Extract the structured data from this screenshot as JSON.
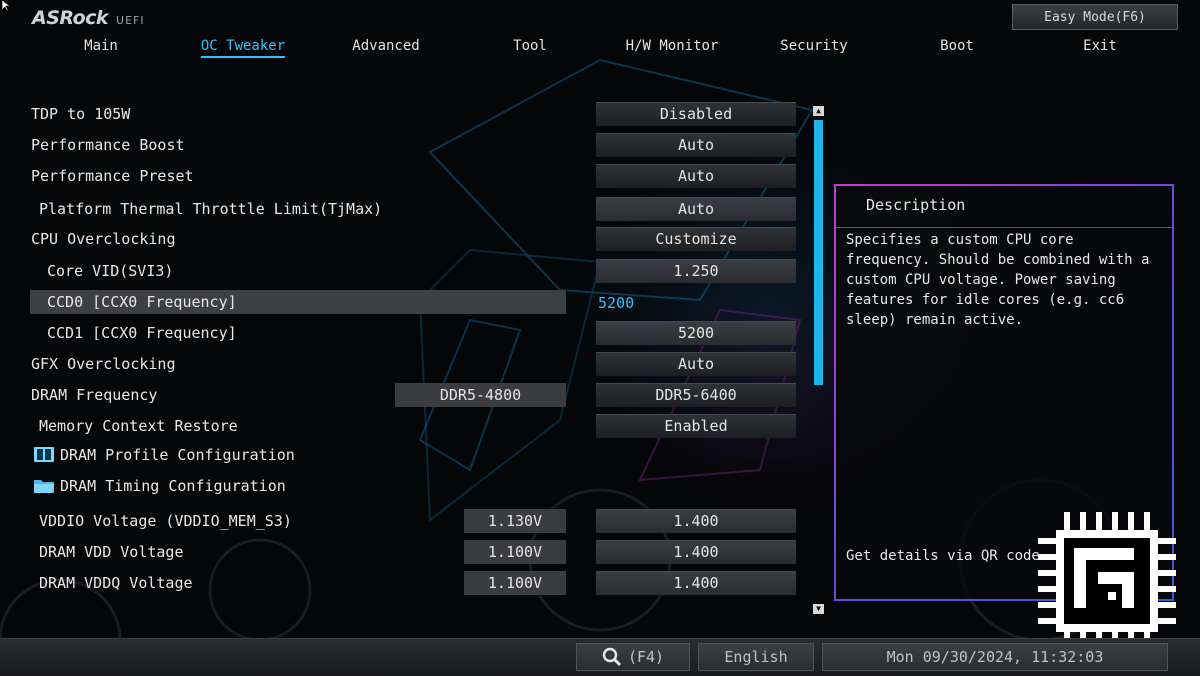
{
  "header": {
    "brand": "ASRock",
    "subtitle": "UEFI",
    "easy_mode": "Easy Mode(F6)"
  },
  "menu": {
    "tabs": [
      {
        "label": "Main"
      },
      {
        "label": "OC Tweaker",
        "active": true
      },
      {
        "label": "Advanced"
      },
      {
        "label": "Tool"
      },
      {
        "label": "H/W Monitor"
      },
      {
        "label": "Security"
      },
      {
        "label": "Boot"
      },
      {
        "label": "Exit"
      }
    ]
  },
  "settings": [
    {
      "label": "TDP to 105W",
      "value": "Disabled"
    },
    {
      "label": "Performance Boost",
      "value": "Auto"
    },
    {
      "label": "Performance Preset",
      "value": "Auto"
    },
    {
      "label": "Platform Thermal Throttle Limit(TjMax)",
      "value": "Auto"
    },
    {
      "label": "CPU Overclocking",
      "value": "Customize"
    },
    {
      "label": "Core VID(SVI3)",
      "value": "1.250"
    },
    {
      "label": "CCD0 [CCX0 Frequency]",
      "value": "5200",
      "selected": true
    },
    {
      "label": "CCD1 [CCX0 Frequency]",
      "value": "5200"
    },
    {
      "label": "GFX Overclocking",
      "value": "Auto"
    },
    {
      "label": "DRAM Frequency",
      "current": "DDR5-4800",
      "value": "DDR5-6400"
    },
    {
      "label": "Memory Context Restore",
      "value": "Enabled"
    },
    {
      "label": "DRAM Profile Configuration",
      "icon": "book-icon"
    },
    {
      "label": "DRAM Timing Configuration",
      "icon": "folder-icon"
    },
    {
      "label": "VDDIO Voltage (VDDIO_MEM_S3)",
      "current": "1.130V",
      "value": "1.400"
    },
    {
      "label": "DRAM VDD Voltage",
      "current": "1.100V",
      "value": "1.400"
    },
    {
      "label": "DRAM VDDQ Voltage",
      "current": "1.100V",
      "value": "1.400"
    }
  ],
  "description": {
    "title": "Description",
    "lines": [
      "Specifies a custom CPU core",
      "frequency. Should be combined with a",
      "custom CPU voltage. Power saving",
      "features for idle cores (e.g. cc6",
      "sleep) remain active."
    ],
    "qr_text": "Get details via QR code."
  },
  "footer": {
    "search": "(F4)",
    "language": "English",
    "datetime": "Mon 09/30/2024, 11:32:03"
  },
  "colors": {
    "accent": "#2fc4ff",
    "panel_border": "#c93bc9"
  }
}
